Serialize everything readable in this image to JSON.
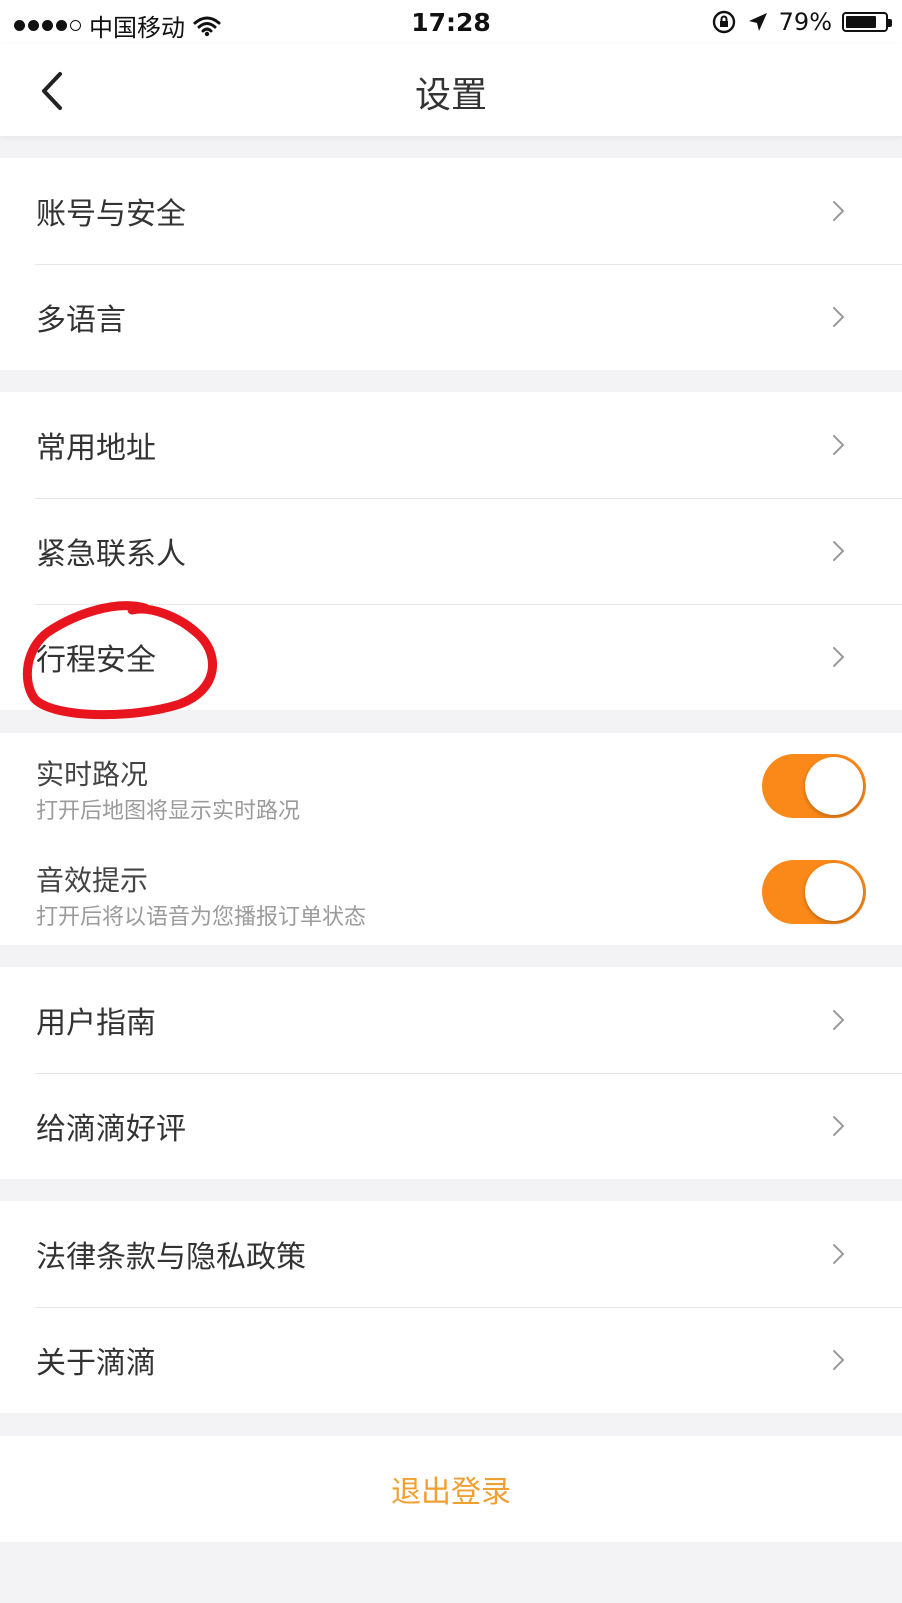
{
  "status_bar": {
    "carrier": "中国移动",
    "time": "17:28",
    "battery_percent": "79%",
    "battery_level": 0.79
  },
  "nav": {
    "title": "设置",
    "back_icon": "chevron-left-icon"
  },
  "groups": [
    {
      "items": [
        {
          "label": "账号与安全"
        },
        {
          "label": "多语言"
        }
      ]
    },
    {
      "items": [
        {
          "label": "常用地址"
        },
        {
          "label": "紧急联系人"
        },
        {
          "label": "行程安全"
        }
      ]
    },
    {
      "toggles": [
        {
          "title": "实时路况",
          "subtitle": "打开后地图将显示实时路况",
          "on": true
        },
        {
          "title": "音效提示",
          "subtitle": "打开后将以语音为您播报订单状态",
          "on": true
        }
      ]
    },
    {
      "items": [
        {
          "label": "用户指南"
        },
        {
          "label": "给滴滴好评"
        }
      ]
    },
    {
      "items": [
        {
          "label": "法律条款与隐私政策"
        },
        {
          "label": "关于滴滴"
        }
      ]
    }
  ],
  "logout": {
    "label": "退出登录"
  },
  "colors": {
    "accent": "#fa8919",
    "logout_text": "#f0a030",
    "annotation": "#e8141e",
    "background": "#f3f3f5"
  }
}
